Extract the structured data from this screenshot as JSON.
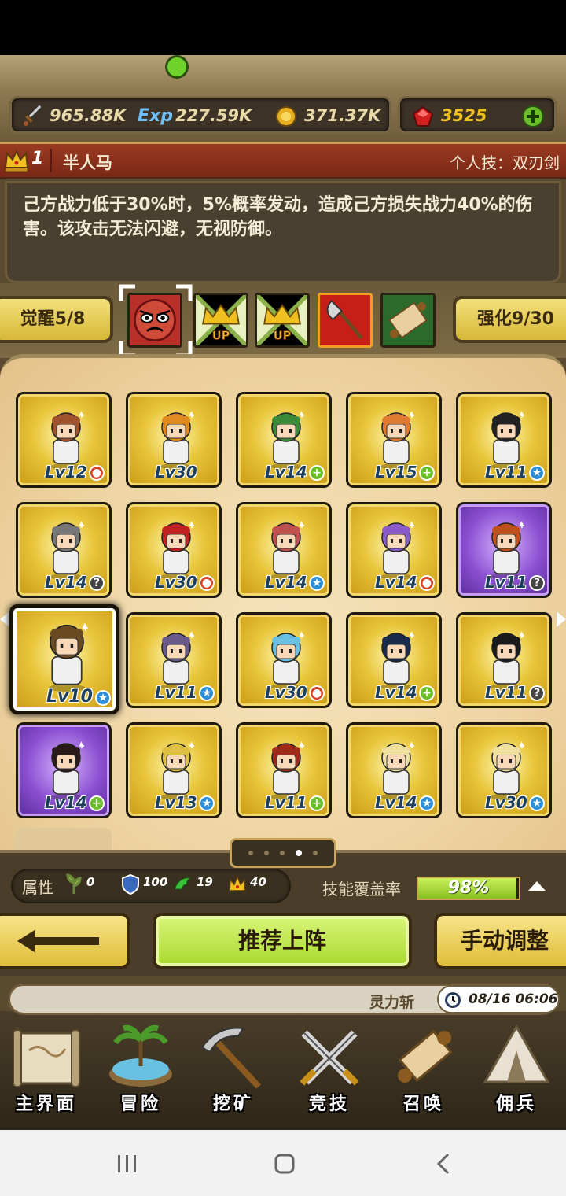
{
  "resources": {
    "attack": "965.88K",
    "exp_label": "Exp",
    "exp": "227.59K",
    "coins": "371.37K",
    "gems": "3525"
  },
  "hero": {
    "rank": "1",
    "name": "半人马",
    "skill_label": "个人技：双刃剑",
    "description": "己方战力低于30%时，5%概率发动，造成己方损失战力40%的伤害。该攻击无法闪避，无视防御。"
  },
  "awaken": {
    "label": "觉醒5/8"
  },
  "enhance": {
    "label": "强化9/30"
  },
  "abilities": [
    "angry-face-icon",
    "crown-up-icon",
    "crown-up-icon",
    "axe-icon",
    "scroll-icon"
  ],
  "ability_up_text": "UP",
  "heroes": [
    {
      "level": "Lv12",
      "badge": "red",
      "frame": "gold",
      "hair": "#a0522d"
    },
    {
      "level": "Lv30",
      "badge": "none",
      "frame": "gold",
      "hair": "#e08a20"
    },
    {
      "level": "Lv14",
      "badge": "green",
      "frame": "gold",
      "hair": "#3a8a3a"
    },
    {
      "level": "Lv15",
      "badge": "green",
      "frame": "gold",
      "hair": "#e07a30"
    },
    {
      "level": "Lv11",
      "badge": "blue",
      "frame": "gold",
      "hair": "#222222"
    },
    {
      "level": "Lv14",
      "badge": "gray",
      "frame": "gold",
      "hair": "#777777"
    },
    {
      "level": "Lv30",
      "badge": "red",
      "frame": "gold",
      "hair": "#c02020"
    },
    {
      "level": "Lv14",
      "badge": "blue",
      "frame": "gold",
      "hair": "#c05050"
    },
    {
      "level": "Lv14",
      "badge": "red",
      "frame": "gold",
      "hair": "#8a5ac8"
    },
    {
      "level": "Lv11",
      "badge": "gray",
      "frame": "purple",
      "hair": "#c0501a"
    },
    {
      "level": "Lv10",
      "badge": "blue",
      "frame": "gold",
      "hair": "#6a4a20"
    },
    {
      "level": "Lv11",
      "badge": "blue",
      "frame": "gold",
      "hair": "#6a5a8a"
    },
    {
      "level": "Lv30",
      "badge": "red",
      "frame": "gold",
      "hair": "#6ac0e0"
    },
    {
      "level": "Lv14",
      "badge": "green",
      "frame": "gold",
      "hair": "#1a2a4a"
    },
    {
      "level": "Lv11",
      "badge": "gray",
      "frame": "gold",
      "hair": "#1a1a1a"
    },
    {
      "level": "Lv14",
      "badge": "green",
      "frame": "purple",
      "hair": "#2a1a1a"
    },
    {
      "level": "Lv13",
      "badge": "blue",
      "frame": "gold",
      "hair": "#e0c040"
    },
    {
      "level": "Lv11",
      "badge": "green",
      "frame": "gold",
      "hair": "#a02a1a"
    },
    {
      "level": "Lv14",
      "badge": "blue",
      "frame": "gold",
      "hair": "#f0e0a0"
    },
    {
      "level": "Lv30",
      "badge": "blue",
      "frame": "gold",
      "hair": "#f0e0a0"
    }
  ],
  "selected_hero_index": 10,
  "stats": {
    "label": "属性",
    "nature": "0",
    "defense": "100",
    "agility": "19",
    "power": "40",
    "coverage_label": "技能覆盖率",
    "coverage_value": "98%",
    "coverage_fraction": 0.98
  },
  "actions": {
    "recommend": "推荐上阵",
    "manual": "手动调整"
  },
  "ticker": {
    "text": "灵力斩",
    "time": "08/16 06:06"
  },
  "nav": [
    "主界面",
    "冒险",
    "挖矿",
    "竞技",
    "召唤",
    "佣兵"
  ],
  "colors": {
    "gold_frame": "#e8c53a",
    "purple_frame": "#8a4fd1",
    "badge_red": "#d8442a",
    "badge_green": "#6cbf2a",
    "badge_blue": "#2a8fd8",
    "accent_green": "#a8d92c"
  }
}
